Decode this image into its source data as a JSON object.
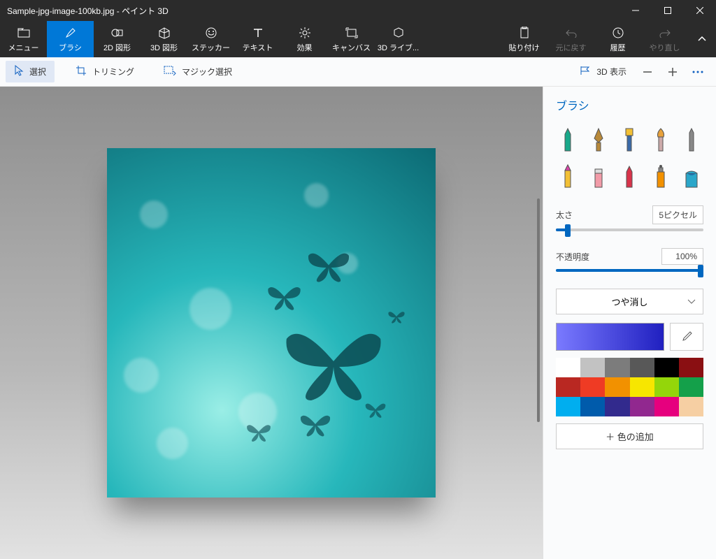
{
  "title": "Sample-jpg-image-100kb.jpg - ペイント 3D",
  "ribbon": {
    "menu": "メニュー",
    "brush": "ブラシ",
    "shapes2d": "2D 図形",
    "shapes3d": "3D 図形",
    "sticker": "ステッカー",
    "text": "テキスト",
    "effect": "効果",
    "canvas": "キャンバス",
    "lib3d": "3D ライブ...",
    "paste": "貼り付け",
    "undo": "元に戻す",
    "history": "履歴",
    "redo": "やり直し"
  },
  "subbar": {
    "select": "選択",
    "crop": "トリミング",
    "magic": "マジック選択",
    "view3d": "3D 表示"
  },
  "side": {
    "title": "ブラシ",
    "thickness_label": "太さ",
    "thickness_value": "5ピクセル",
    "opacity_label": "不透明度",
    "opacity_value": "100%",
    "finish": "つや消し",
    "add_color": "色の追加"
  },
  "palette": [
    "#ffffff",
    "#c2c2c2",
    "#7c7c7c",
    "#585858",
    "#000000",
    "#8a0f12",
    "#b92822",
    "#ef3b24",
    "#f29100",
    "#f7e600",
    "#94d60a",
    "#14a04a",
    "#00aeef",
    "#005bab",
    "#322a8d",
    "#91288f",
    "#e6007e",
    "#f6cfa3"
  ]
}
